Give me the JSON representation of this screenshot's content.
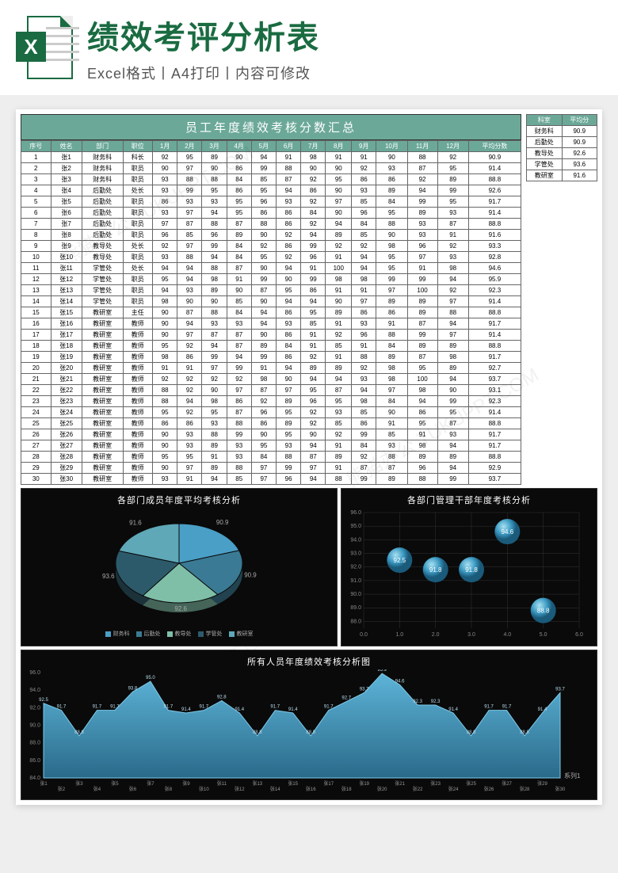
{
  "banner": {
    "title": "绩效考评分析表",
    "subtitle": "Excel格式丨A4打印丨内容可修改",
    "icon_letter": "X"
  },
  "table": {
    "title": "员工年度绩效考核分数汇总",
    "headers": [
      "序号",
      "姓名",
      "部门",
      "职位",
      "1月",
      "2月",
      "3月",
      "4月",
      "5月",
      "6月",
      "7月",
      "8月",
      "9月",
      "10月",
      "11月",
      "12月",
      "平均分数"
    ],
    "rows": [
      {
        "c": [
          "1",
          "张1",
          "财务科",
          "科长",
          "92",
          "95",
          "89",
          "90",
          "94",
          "91",
          "98",
          "91",
          "91",
          "90",
          "88",
          "92",
          "90.9"
        ]
      },
      {
        "c": [
          "2",
          "张2",
          "财务科",
          "职员",
          "90",
          "97",
          "90",
          "86",
          "99",
          "88",
          "90",
          "90",
          "92",
          "93",
          "87",
          "95",
          "91.4"
        ]
      },
      {
        "c": [
          "3",
          "张3",
          "财务科",
          "职员",
          "93",
          "88",
          "88",
          "84",
          "85",
          "87",
          "92",
          "95",
          "86",
          "86",
          "92",
          "89",
          "88.8"
        ]
      },
      {
        "c": [
          "4",
          "张4",
          "后勤处",
          "处长",
          "93",
          "99",
          "95",
          "86",
          "95",
          "94",
          "86",
          "90",
          "93",
          "89",
          "94",
          "99",
          "92.6"
        ]
      },
      {
        "c": [
          "5",
          "张5",
          "后勤处",
          "职员",
          "86",
          "93",
          "93",
          "95",
          "96",
          "93",
          "92",
          "97",
          "85",
          "84",
          "99",
          "95",
          "91.7"
        ]
      },
      {
        "c": [
          "6",
          "张6",
          "后勤处",
          "职员",
          "93",
          "97",
          "94",
          "95",
          "86",
          "86",
          "84",
          "90",
          "96",
          "95",
          "89",
          "93",
          "91.4"
        ]
      },
      {
        "c": [
          "7",
          "张7",
          "后勤处",
          "职员",
          "97",
          "87",
          "88",
          "87",
          "88",
          "86",
          "92",
          "94",
          "84",
          "88",
          "93",
          "87",
          "88.8"
        ]
      },
      {
        "c": [
          "8",
          "张8",
          "后勤处",
          "职员",
          "96",
          "85",
          "96",
          "89",
          "90",
          "92",
          "94",
          "89",
          "85",
          "90",
          "93",
          "91",
          "91.6"
        ]
      },
      {
        "c": [
          "9",
          "张9",
          "教导处",
          "处长",
          "92",
          "97",
          "99",
          "84",
          "92",
          "86",
          "99",
          "92",
          "92",
          "98",
          "96",
          "92",
          "93.3"
        ]
      },
      {
        "c": [
          "10",
          "张10",
          "教导处",
          "职员",
          "93",
          "88",
          "94",
          "84",
          "95",
          "92",
          "96",
          "91",
          "94",
          "95",
          "97",
          "93",
          "92.8"
        ]
      },
      {
        "c": [
          "11",
          "张11",
          "学管处",
          "处长",
          "94",
          "94",
          "88",
          "87",
          "90",
          "94",
          "91",
          "100",
          "94",
          "95",
          "91",
          "98",
          "94.6"
        ]
      },
      {
        "c": [
          "12",
          "张12",
          "学管处",
          "职员",
          "95",
          "94",
          "98",
          "91",
          "99",
          "90",
          "99",
          "98",
          "98",
          "99",
          "99",
          "94",
          "95.9"
        ]
      },
      {
        "c": [
          "13",
          "张13",
          "学管处",
          "职员",
          "94",
          "93",
          "89",
          "90",
          "87",
          "95",
          "86",
          "91",
          "91",
          "97",
          "100",
          "92",
          "92.3"
        ]
      },
      {
        "c": [
          "14",
          "张14",
          "学管处",
          "职员",
          "98",
          "90",
          "90",
          "85",
          "90",
          "94",
          "94",
          "90",
          "97",
          "89",
          "89",
          "97",
          "91.4"
        ]
      },
      {
        "c": [
          "15",
          "张15",
          "教研室",
          "主任",
          "90",
          "87",
          "88",
          "84",
          "94",
          "86",
          "95",
          "89",
          "86",
          "86",
          "89",
          "88",
          "88.8"
        ]
      },
      {
        "c": [
          "16",
          "张16",
          "教研室",
          "教师",
          "90",
          "94",
          "93",
          "93",
          "94",
          "93",
          "85",
          "91",
          "93",
          "91",
          "87",
          "94",
          "91.7"
        ]
      },
      {
        "c": [
          "17",
          "张17",
          "教研室",
          "教师",
          "90",
          "97",
          "87",
          "87",
          "90",
          "86",
          "91",
          "92",
          "96",
          "88",
          "99",
          "97",
          "91.4"
        ]
      },
      {
        "c": [
          "18",
          "张18",
          "教研室",
          "教师",
          "95",
          "92",
          "94",
          "87",
          "89",
          "84",
          "91",
          "85",
          "91",
          "84",
          "89",
          "89",
          "88.8"
        ]
      },
      {
        "c": [
          "19",
          "张19",
          "教研室",
          "教师",
          "98",
          "86",
          "99",
          "94",
          "99",
          "86",
          "92",
          "91",
          "88",
          "89",
          "87",
          "98",
          "91.7"
        ]
      },
      {
        "c": [
          "20",
          "张20",
          "教研室",
          "教师",
          "91",
          "91",
          "97",
          "99",
          "91",
          "94",
          "89",
          "89",
          "92",
          "98",
          "95",
          "89",
          "92.7"
        ]
      },
      {
        "c": [
          "21",
          "张21",
          "教研室",
          "教师",
          "92",
          "92",
          "92",
          "92",
          "98",
          "90",
          "94",
          "94",
          "93",
          "98",
          "100",
          "94",
          "93.7"
        ]
      },
      {
        "c": [
          "22",
          "张22",
          "教研室",
          "教师",
          "88",
          "92",
          "90",
          "97",
          "87",
          "97",
          "95",
          "87",
          "94",
          "97",
          "98",
          "90",
          "93.1"
        ]
      },
      {
        "c": [
          "23",
          "张23",
          "教研室",
          "教师",
          "88",
          "94",
          "98",
          "86",
          "92",
          "89",
          "96",
          "95",
          "98",
          "84",
          "94",
          "99",
          "92.3"
        ]
      },
      {
        "c": [
          "24",
          "张24",
          "教研室",
          "教师",
          "95",
          "92",
          "95",
          "87",
          "96",
          "95",
          "92",
          "93",
          "85",
          "90",
          "86",
          "95",
          "91.4"
        ]
      },
      {
        "c": [
          "25",
          "张25",
          "教研室",
          "教师",
          "86",
          "86",
          "93",
          "88",
          "86",
          "89",
          "92",
          "85",
          "86",
          "91",
          "95",
          "87",
          "88.8"
        ]
      },
      {
        "c": [
          "26",
          "张26",
          "教研室",
          "教师",
          "90",
          "93",
          "88",
          "99",
          "90",
          "95",
          "90",
          "92",
          "99",
          "85",
          "91",
          "93",
          "91.7"
        ]
      },
      {
        "c": [
          "27",
          "张27",
          "教研室",
          "教师",
          "90",
          "93",
          "89",
          "93",
          "95",
          "93",
          "94",
          "91",
          "84",
          "93",
          "98",
          "94",
          "91.7"
        ]
      },
      {
        "c": [
          "28",
          "张28",
          "教研室",
          "教师",
          "95",
          "95",
          "91",
          "93",
          "84",
          "88",
          "87",
          "89",
          "92",
          "88",
          "89",
          "89",
          "88.8"
        ]
      },
      {
        "c": [
          "29",
          "张29",
          "教研室",
          "教师",
          "90",
          "97",
          "89",
          "88",
          "97",
          "99",
          "97",
          "91",
          "87",
          "87",
          "96",
          "94",
          "92.9"
        ]
      },
      {
        "c": [
          "30",
          "张30",
          "教研室",
          "教师",
          "93",
          "91",
          "94",
          "85",
          "97",
          "96",
          "94",
          "88",
          "99",
          "89",
          "88",
          "99",
          "93.7"
        ]
      }
    ]
  },
  "side_table": {
    "headers": [
      "科室",
      "平均分"
    ],
    "rows": [
      {
        "c": [
          "财务科",
          "90.9"
        ]
      },
      {
        "c": [
          "后勤处",
          "90.9"
        ]
      },
      {
        "c": [
          "教导处",
          "92.6"
        ]
      },
      {
        "c": [
          "学管处",
          "93.6"
        ]
      },
      {
        "c": [
          "教研室",
          "91.6"
        ]
      }
    ]
  },
  "chart_data": [
    {
      "type": "pie",
      "title": "各部门成员年度平均考核分析",
      "series": [
        {
          "name": "财务科",
          "value": 90.9,
          "color": "#4a9fc7"
        },
        {
          "name": "后勤处",
          "value": 90.9,
          "color": "#3a7a94"
        },
        {
          "name": "教导处",
          "value": 92.6,
          "color": "#7fbfa8"
        },
        {
          "name": "学管处",
          "value": 93.6,
          "color": "#2d5a6b"
        },
        {
          "name": "教研室",
          "value": 91.6,
          "color": "#5ea8b8"
        }
      ]
    },
    {
      "type": "scatter",
      "title": "各部门管理干部年度考核分析",
      "xlabel": "",
      "ylabel": "",
      "xlim": [
        0,
        6
      ],
      "ylim": [
        87.5,
        96
      ],
      "yticks": [
        88,
        89,
        90,
        91,
        92,
        93,
        94,
        95,
        96
      ],
      "points": [
        {
          "x": 1,
          "y": 92.5,
          "label": "92.5"
        },
        {
          "x": 2,
          "y": 91.8,
          "label": "91.8"
        },
        {
          "x": 3,
          "y": 91.8,
          "label": "91.8"
        },
        {
          "x": 4,
          "y": 94.6,
          "label": "94.6"
        },
        {
          "x": 5,
          "y": 88.8,
          "label": "88.8"
        }
      ]
    },
    {
      "type": "area",
      "title": "所有人员年度绩效考核分析图",
      "ylim": [
        84,
        96
      ],
      "yticks": [
        84,
        86,
        88,
        90,
        92,
        94,
        96
      ],
      "legend": "系列1",
      "categories": [
        "张1",
        "张2",
        "张3",
        "张4",
        "张5",
        "张6",
        "张7",
        "张8",
        "张9",
        "张10",
        "张11",
        "张12",
        "张13",
        "张14",
        "张15",
        "张16",
        "张17",
        "张18",
        "张19",
        "张20",
        "张21",
        "张22",
        "张23",
        "张24",
        "张25",
        "张26",
        "张27",
        "张28",
        "张29",
        "张30"
      ],
      "values": [
        92.5,
        91.7,
        88.8,
        91.7,
        91.7,
        93.8,
        95.0,
        91.7,
        91.4,
        91.7,
        92.8,
        91.4,
        88.8,
        91.7,
        91.4,
        88.8,
        91.7,
        92.7,
        93.7,
        95.9,
        94.6,
        92.3,
        92.3,
        91.4,
        88.8,
        91.7,
        91.7,
        88.8,
        91.4,
        93.7
      ]
    }
  ],
  "watermark": "熊猫办公 TUKUPPT.COM"
}
